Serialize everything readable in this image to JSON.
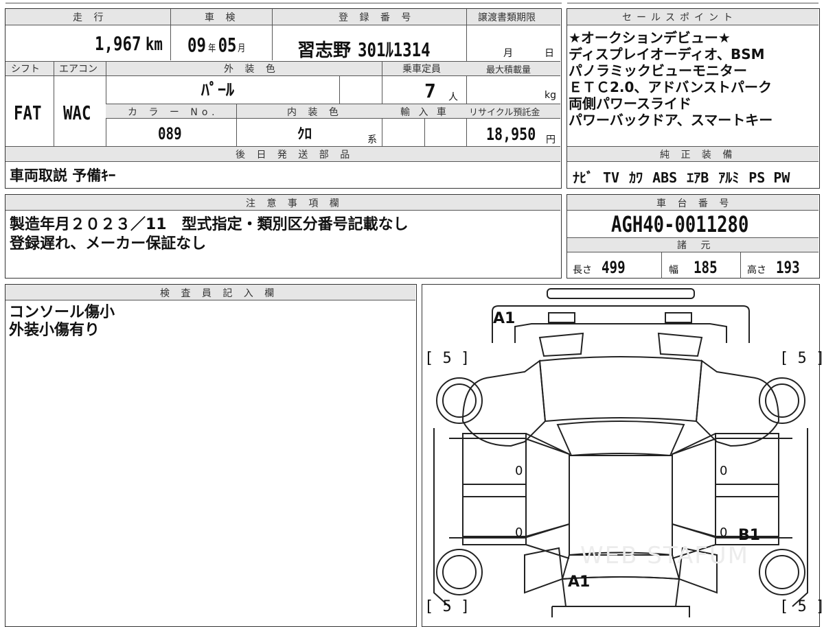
{
  "mileage": {
    "label": "走 行",
    "value": "1,967",
    "unit": "km"
  },
  "inspection": {
    "label": "車 検",
    "year": "09",
    "year_unit": "年",
    "month": "05",
    "month_unit": "月"
  },
  "registration": {
    "label": "登 録 番 号",
    "region": "習志野",
    "number": "301ﾙ1314"
  },
  "transfer_deadline": {
    "label": "譲渡書類期限",
    "month_unit": "月",
    "day_unit": "日"
  },
  "shift": {
    "label": "シフト",
    "value": "FAT"
  },
  "aircon": {
    "label": "エアコン",
    "value": "WAC"
  },
  "exterior_color": {
    "label": "外 装 色",
    "value": "ﾊﾟｰﾙ"
  },
  "capacity": {
    "label": "乗車定員",
    "value": "7",
    "unit": "人"
  },
  "max_load": {
    "label": "最大積載量",
    "unit": "kg"
  },
  "color_no": {
    "label": "カ ラ ー No.",
    "value": "089"
  },
  "interior_color": {
    "label": "内 装 色",
    "value": "ｸﾛ",
    "suffix": "系"
  },
  "import": {
    "label": "輸 入 車"
  },
  "recycle": {
    "label": "リサイクル預託金",
    "value": "18,950",
    "unit": "円"
  },
  "later_parts": {
    "label": "後 日 発 送 部 品",
    "value": "車両取説 予備ｷｰ"
  },
  "sales_points": {
    "label": "セールスポイント",
    "lines": [
      "★オークションデビュー★",
      "ディスプレイオーディオ、BSM",
      "パノラミックビューモニター",
      "ＥＴＣ2.0、アドバンストパーク",
      "両側パワースライド",
      "パワーバックドア、スマートキー"
    ]
  },
  "equipment": {
    "label": "純 正 装 備",
    "items": [
      "ﾅﾋﾞ",
      "TV",
      "ｶﾜ",
      "ABS",
      "ｴｱB",
      "ｱﾙﾐ",
      "PS",
      "PW"
    ]
  },
  "notes": {
    "label": "注 意 事 項 欄",
    "lines": [
      "製造年月２０２３／11　型式指定・類別区分番号記載なし",
      "登録遅れ、メーカー保証なし"
    ]
  },
  "chassis": {
    "label": "車 台 番 号",
    "value": "AGH40-0011280"
  },
  "specs": {
    "label": "諸 元",
    "length_label": "長さ",
    "length": "499",
    "width_label": "幅",
    "width": "185",
    "height_label": "高さ",
    "height": "193"
  },
  "inspector": {
    "label": "検 査 員 記 入 欄",
    "lines": [
      "コンソール傷小",
      "外装小傷有り"
    ]
  },
  "diagram": {
    "marks": {
      "front": "A1",
      "rear": "A1",
      "right_rear": "B1"
    },
    "tires": {
      "fl": "[ 5 ]",
      "fr": "[ 5 ]",
      "rl": "[ 5 ]",
      "rr": "[ 5 ]"
    },
    "zeros": [
      "0",
      "0",
      "0",
      "0"
    ],
    "watermark": "WEB STAFUM"
  }
}
